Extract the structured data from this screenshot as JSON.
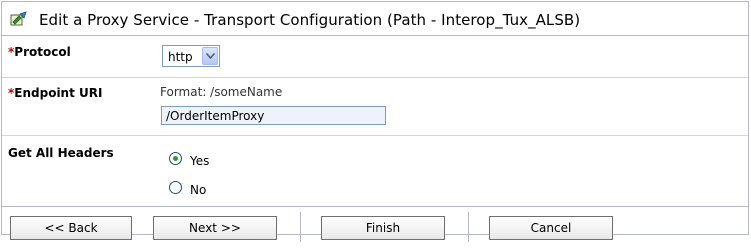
{
  "header": {
    "title": "Edit a Proxy Service - Transport Configuration (Path - Interop_Tux_ALSB)",
    "icon": "edit-document-icon"
  },
  "form": {
    "protocol": {
      "required_marker": "*",
      "label": "Protocol",
      "value": "http"
    },
    "endpoint": {
      "required_marker": "*",
      "label": "Endpoint URI",
      "hint": "Format: /someName",
      "value": "/OrderItemProxy"
    },
    "headers": {
      "label": "Get All Headers",
      "options": [
        {
          "label": "Yes",
          "checked": true
        },
        {
          "label": "No",
          "checked": false
        }
      ]
    }
  },
  "buttons": {
    "back": "<< Back",
    "next": "Next >>",
    "finish": "Finish",
    "cancel": "Cancel"
  }
}
